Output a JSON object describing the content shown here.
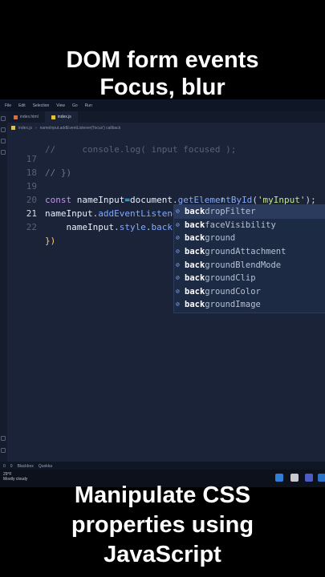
{
  "captions": {
    "top": [
      "DOM form events",
      "Focus, blur"
    ],
    "bottom": [
      "Manipulate CSS",
      "properties using",
      "JavaScript"
    ]
  },
  "editor": {
    "menu": [
      "File",
      "Edit",
      "Selection",
      "View",
      "Go",
      "Run"
    ],
    "tabs": [
      {
        "label": "index.html",
        "active": false
      },
      {
        "label": "index.js",
        "active": true
      }
    ],
    "breadcrumb": [
      "index.js",
      "nameInput.addEventListener('focus') callback"
    ],
    "lines": [
      {
        "n": "17",
        "code": "// })"
      },
      {
        "n": "18",
        "code": ""
      },
      {
        "n": "19",
        "code": "const nameInput=document.getElementById('myInput');"
      },
      {
        "n": "20",
        "code": "nameInput.addEventListener('focus', ()=>{"
      },
      {
        "n": "21",
        "code": "    nameInput.style.back"
      },
      {
        "n": "22",
        "code": "})"
      }
    ],
    "partial_line": "//     console.log( input focused );",
    "suggestions": {
      "prefix": "back",
      "items": [
        "backdropFilter",
        "backfaceVisibility",
        "background",
        "backgroundAttachment",
        "backgroundBlendMode",
        "backgroundClip",
        "backgroundColor",
        "backgroundImage"
      ]
    },
    "status": [
      "0",
      "0",
      "Blackbox",
      "Quokka"
    ]
  },
  "taskbar": {
    "weather_temp": "29°F",
    "weather_desc": "Mostly cloudy"
  },
  "colors": {
    "editor_bg": "#1a2337",
    "suggest_bg": "#1d2a44",
    "keyword": "#c792ea",
    "function": "#82aaff",
    "string": "#c3e88d"
  }
}
